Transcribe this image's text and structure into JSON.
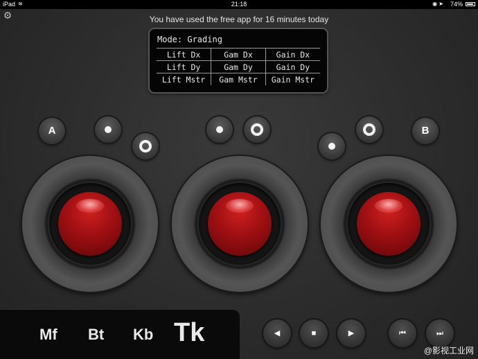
{
  "status_bar": {
    "carrier": "iPad",
    "wifi_icon": "wifi-icon",
    "time": "21:18",
    "lock_icon": "orientation-lock-icon",
    "location_icon": "location-icon",
    "battery_text": "74%",
    "battery_level": 0.74
  },
  "settings_icon": "gear-icon",
  "banner": "You have used the free app for 16 minutes today",
  "display": {
    "mode": "Mode: Grading",
    "rows": [
      [
        "Lift Dx",
        "Gam Dx",
        "Gain Dx"
      ],
      [
        "Lift Dy",
        "Gam Dy",
        "Gain Dy"
      ],
      [
        "Lift Mstr",
        "Gam Mstr",
        "Gain Mstr"
      ]
    ]
  },
  "buttons": {
    "a_label": "A",
    "b_label": "B"
  },
  "trackballs": [
    "lift",
    "gamma",
    "gain"
  ],
  "modes": {
    "mf": "Mf",
    "bt": "Bt",
    "kb": "Kb",
    "tk": "Tk",
    "selected": "Tk"
  },
  "transport": {
    "rewind": "◀",
    "stop": "■",
    "play": "▶",
    "prev": "⏮",
    "next": "⏭"
  },
  "watermark": "@影视工业网",
  "colors": {
    "trackball": "#9e0f12",
    "background": "#2c2c2c",
    "lcd": "#050505"
  }
}
